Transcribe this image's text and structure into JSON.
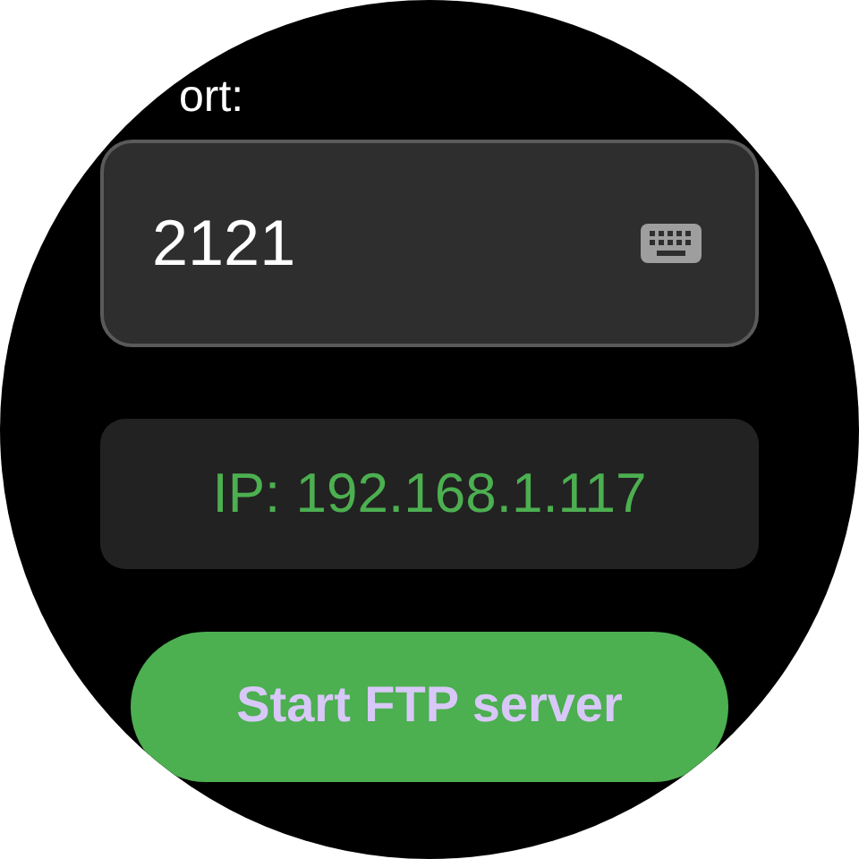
{
  "port_label": "ort:",
  "port_field": {
    "value": "2121"
  },
  "ip_text": "IP: 192.168.1.117",
  "start_button": {
    "label": "Start FTP server"
  }
}
